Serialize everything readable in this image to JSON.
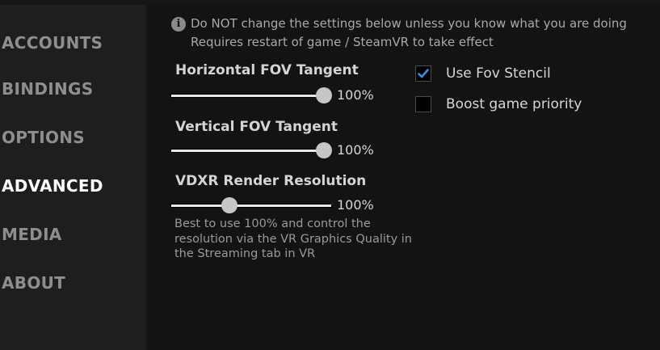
{
  "sidebar": {
    "items": [
      {
        "label": "ACCOUNTS",
        "active": false
      },
      {
        "label": "BINDINGS",
        "active": false
      },
      {
        "label": "OPTIONS",
        "active": false
      },
      {
        "label": "ADVANCED",
        "active": true
      },
      {
        "label": "MEDIA",
        "active": false
      },
      {
        "label": "ABOUT",
        "active": false
      }
    ]
  },
  "notice": {
    "icon": "info-icon",
    "line1": "Do NOT change the settings below unless you know what you are doing",
    "line2": "Requires restart of game / SteamVR to take effect"
  },
  "sliders": [
    {
      "label": "Horizontal FOV Tangent",
      "value_text": "100%",
      "fraction": 1.0
    },
    {
      "label": "Vertical FOV Tangent",
      "value_text": "100%",
      "fraction": 1.0
    },
    {
      "label": "VDXR Render Resolution",
      "value_text": "100%",
      "fraction": 0.35
    }
  ],
  "render_hint": "Best to use 100% and control the resolution via the VR Graphics Quality in the Streaming tab in VR",
  "checkboxes": [
    {
      "label": "Use Fov Stencil",
      "checked": true
    },
    {
      "label": "Boost game priority",
      "checked": false
    }
  ],
  "colors": {
    "background": "#131313",
    "sidebar": "#1e1e1e",
    "active_nav": "#ffffff",
    "inactive_nav": "#8e8e8e",
    "checkmark": "#3a8ee6"
  }
}
